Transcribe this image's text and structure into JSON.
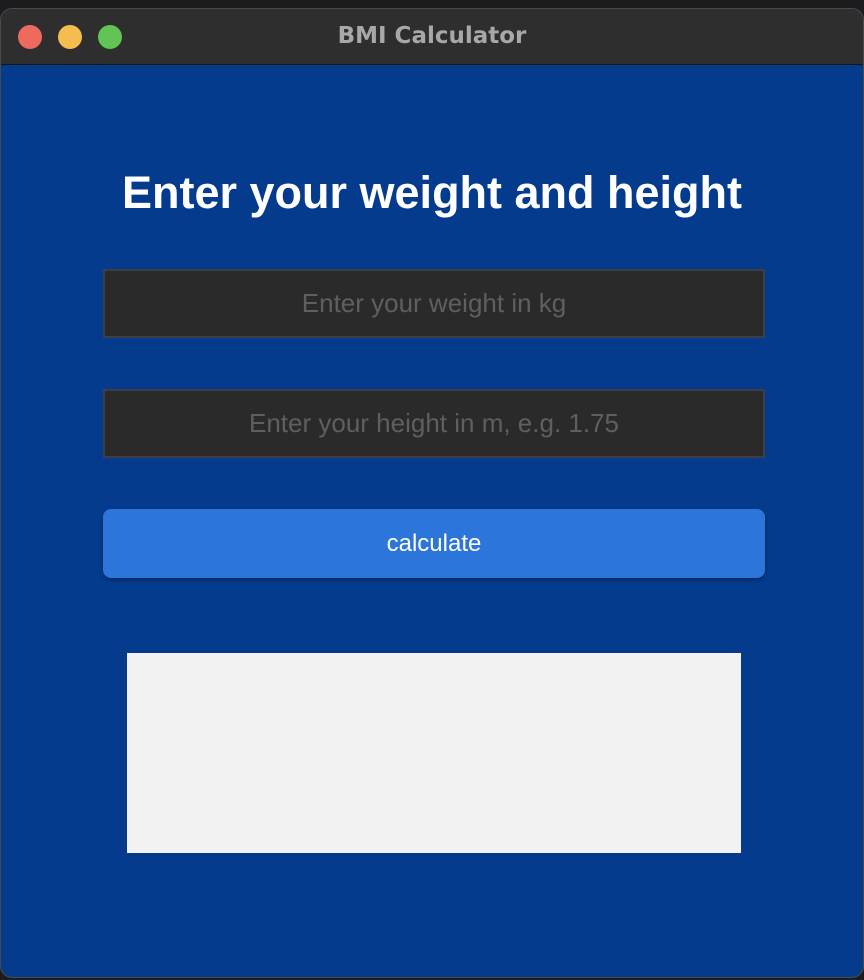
{
  "window": {
    "title": "BMI Calculator"
  },
  "form": {
    "heading": "Enter your weight and height",
    "weight_placeholder": "Enter your weight in kg",
    "weight_value": "",
    "height_placeholder": "Enter your height in m, e.g. 1.75",
    "height_value": "",
    "calculate_label": "calculate"
  },
  "result": {
    "text": ""
  },
  "colors": {
    "background": "#043b8d",
    "button": "#2c75db",
    "field": "#2a2a2a",
    "result_box": "#f2f2f2"
  },
  "icons": {
    "close": "close-traffic-light-icon",
    "minimize": "minimize-traffic-light-icon",
    "zoom": "zoom-traffic-light-icon"
  }
}
